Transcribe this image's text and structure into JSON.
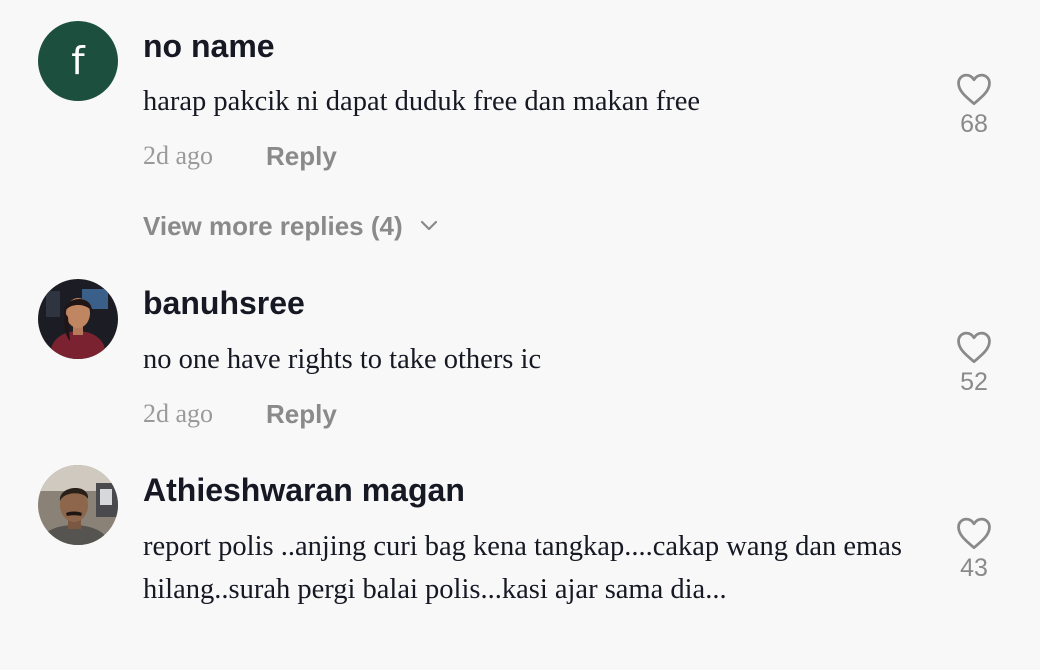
{
  "comments": [
    {
      "avatar_letter": "f",
      "avatar_color": "#1d4f3f",
      "username": "no name",
      "text": "harap pakcik ni dapat duduk free dan makan free",
      "time": "2d ago",
      "reply_label": "Reply",
      "likes": "68",
      "view_more": "View more replies (4)"
    },
    {
      "username": "banuhsree",
      "text": "no one have rights to take others ic",
      "time": "2d ago",
      "reply_label": "Reply",
      "likes": "52"
    },
    {
      "username": "Athieshwaran magan",
      "text": "report polis ..anjing curi bag kena tangkap....cakap wang dan emas hilang..surah pergi balai polis...kasi ajar sama dia...",
      "likes": "43"
    }
  ],
  "icons": {
    "like": "heart-outline-icon",
    "expand": "chevron-down-icon"
  },
  "colors": {
    "background": "#f8f8f8",
    "text_primary": "#161823",
    "text_secondary": "#8a8a8a"
  }
}
